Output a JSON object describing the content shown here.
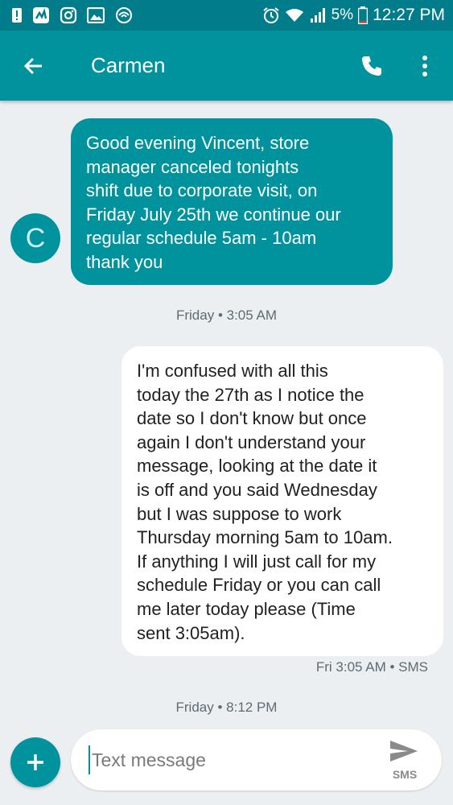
{
  "status_bar": {
    "time": "12:27 PM",
    "battery_percent": "5%",
    "left_icons": [
      "alert-icon",
      "news-icon",
      "instagram-icon",
      "gallery-icon",
      "wifi-hotspot-icon"
    ],
    "right_icons": [
      "alarm-icon",
      "wifi-icon",
      "signal-icon",
      "battery-icon"
    ]
  },
  "app_bar": {
    "title": "Carmen",
    "back_icon": "arrow-left-icon",
    "call_icon": "phone-icon",
    "menu_icon": "more-vert-icon"
  },
  "conversation": {
    "contact_initial": "C",
    "messages": [
      {
        "direction": "incoming",
        "lines": [
          "Good evening Vincent, store",
          "manager canceled tonights",
          "shift due to corporate visit, on",
          "Friday July 25th we continue our",
          "regular schedule 5am - 10am",
          "thank you"
        ],
        "timestamp": "Friday • 3:05 AM"
      },
      {
        "direction": "outgoing",
        "lines": [
          "I'm confused with all this",
          "today the 27th as I notice the",
          "date so I don't know but once",
          "again I don't understand your",
          "message,  looking at the date it",
          "is off and you said Wednesday",
          "but I was suppose to work",
          "Thursday morning 5am to 10am.",
          "If anything I will just call for my",
          "schedule Friday or you can call",
          "me later today please (Time",
          "sent 3:05am)."
        ],
        "status": "Fri 3:05 AM • SMS"
      }
    ],
    "last_stamp": "Friday • 8:12 PM"
  },
  "compose": {
    "placeholder": "Text message",
    "send_label": "SMS",
    "add_icon": "plus-icon",
    "send_icon": "send-icon"
  },
  "colors": {
    "status_bar": "#007c8a",
    "app_bar": "#00939e",
    "incoming_bubble": "#00939e",
    "outgoing_bubble": "#ffffff",
    "background": "#eceff1"
  }
}
